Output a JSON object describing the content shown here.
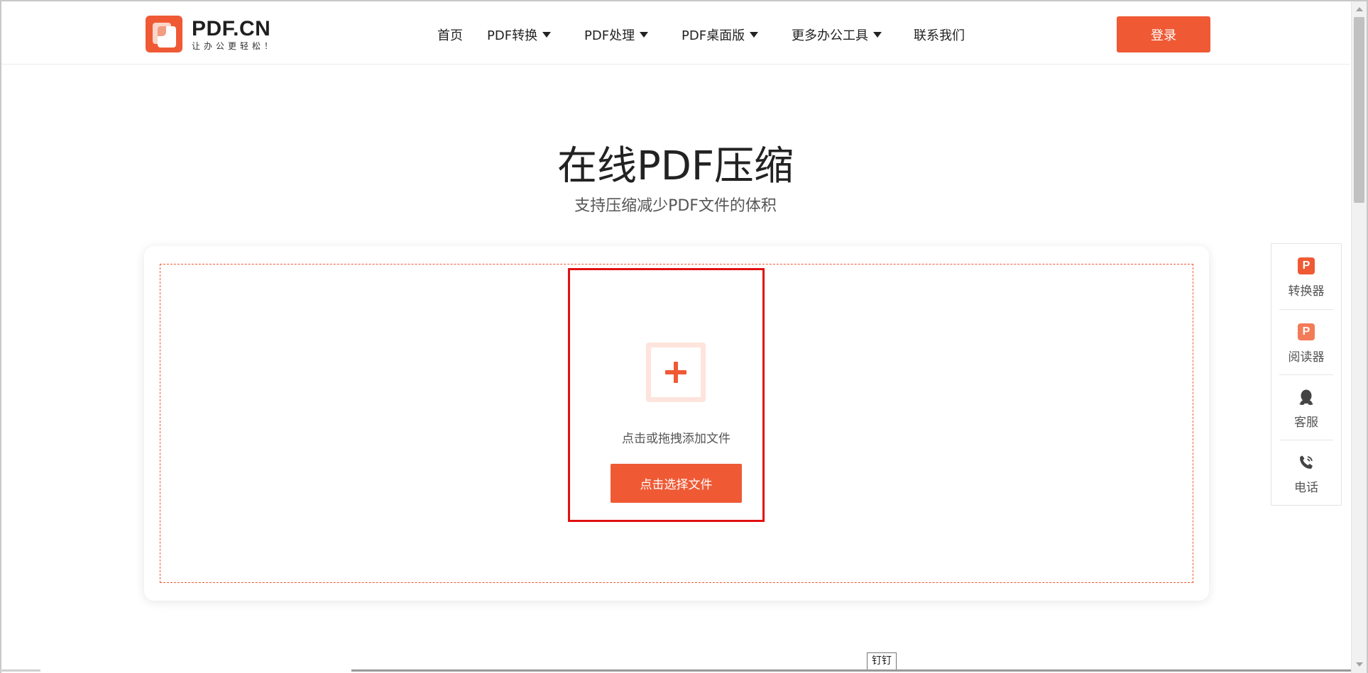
{
  "brand": {
    "name": "PDF.CN",
    "slogan": "让办公更轻松！",
    "color": "#ef5a35"
  },
  "nav": {
    "items": [
      {
        "label": "首页",
        "has_dropdown": false
      },
      {
        "label": "PDF转换",
        "has_dropdown": true
      },
      {
        "label": "PDF处理",
        "has_dropdown": true
      },
      {
        "label": "PDF桌面版",
        "has_dropdown": true
      },
      {
        "label": "更多办公工具",
        "has_dropdown": true
      },
      {
        "label": "联系我们",
        "has_dropdown": false
      }
    ],
    "login_label": "登录"
  },
  "hero": {
    "title": "在线PDF压缩",
    "subtitle": "支持压缩减少PDF文件的体积"
  },
  "upload": {
    "hint": "点击或拖拽添加文件",
    "button_label": "点击选择文件",
    "icon": "plus-icon"
  },
  "sidebar": {
    "items": [
      {
        "label": "转换器",
        "icon": "converter-app-icon"
      },
      {
        "label": "阅读器",
        "icon": "reader-app-icon"
      },
      {
        "label": "客服",
        "icon": "qq-support-icon"
      },
      {
        "label": "电话",
        "icon": "phone-icon"
      }
    ]
  },
  "tooltip": {
    "text": "钉钉"
  }
}
